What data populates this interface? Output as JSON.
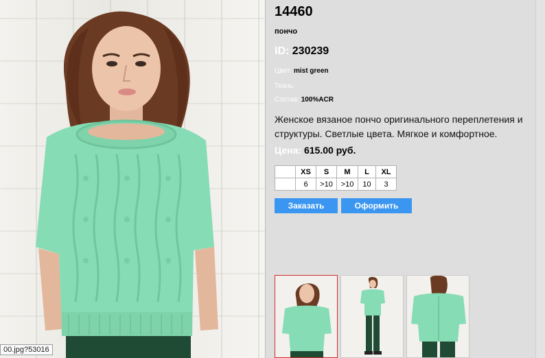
{
  "product": {
    "article": "14460",
    "type": "пончо",
    "id_label": "ID:",
    "id_value": "230239",
    "color_label": "Цвет:",
    "color_value": "mist green",
    "fabric_label": "Ткань:",
    "fabric_value": "",
    "composition_label": "Состав:",
    "composition_value": "100%ACR",
    "description": "Женское вязаное пончо оригинального переплетения и структуры. Светлые цвета. Мягкое и комфортное.",
    "price_label": "Цена:",
    "price_value": "615.00 руб."
  },
  "sizes": {
    "headers": [
      "",
      "XS",
      "S",
      "M",
      "L",
      "XL"
    ],
    "stock": [
      "",
      "6",
      ">10",
      ">10",
      "10",
      "3"
    ]
  },
  "buttons": {
    "order": "Заказать",
    "checkout": "Оформить"
  },
  "status_tooltip": "00.jpg?53016",
  "colors": {
    "accent": "#3a96f0",
    "panel_bg": "#dedede",
    "garment": "#86dcb4",
    "active_thumb_border": "#d42b2b"
  }
}
